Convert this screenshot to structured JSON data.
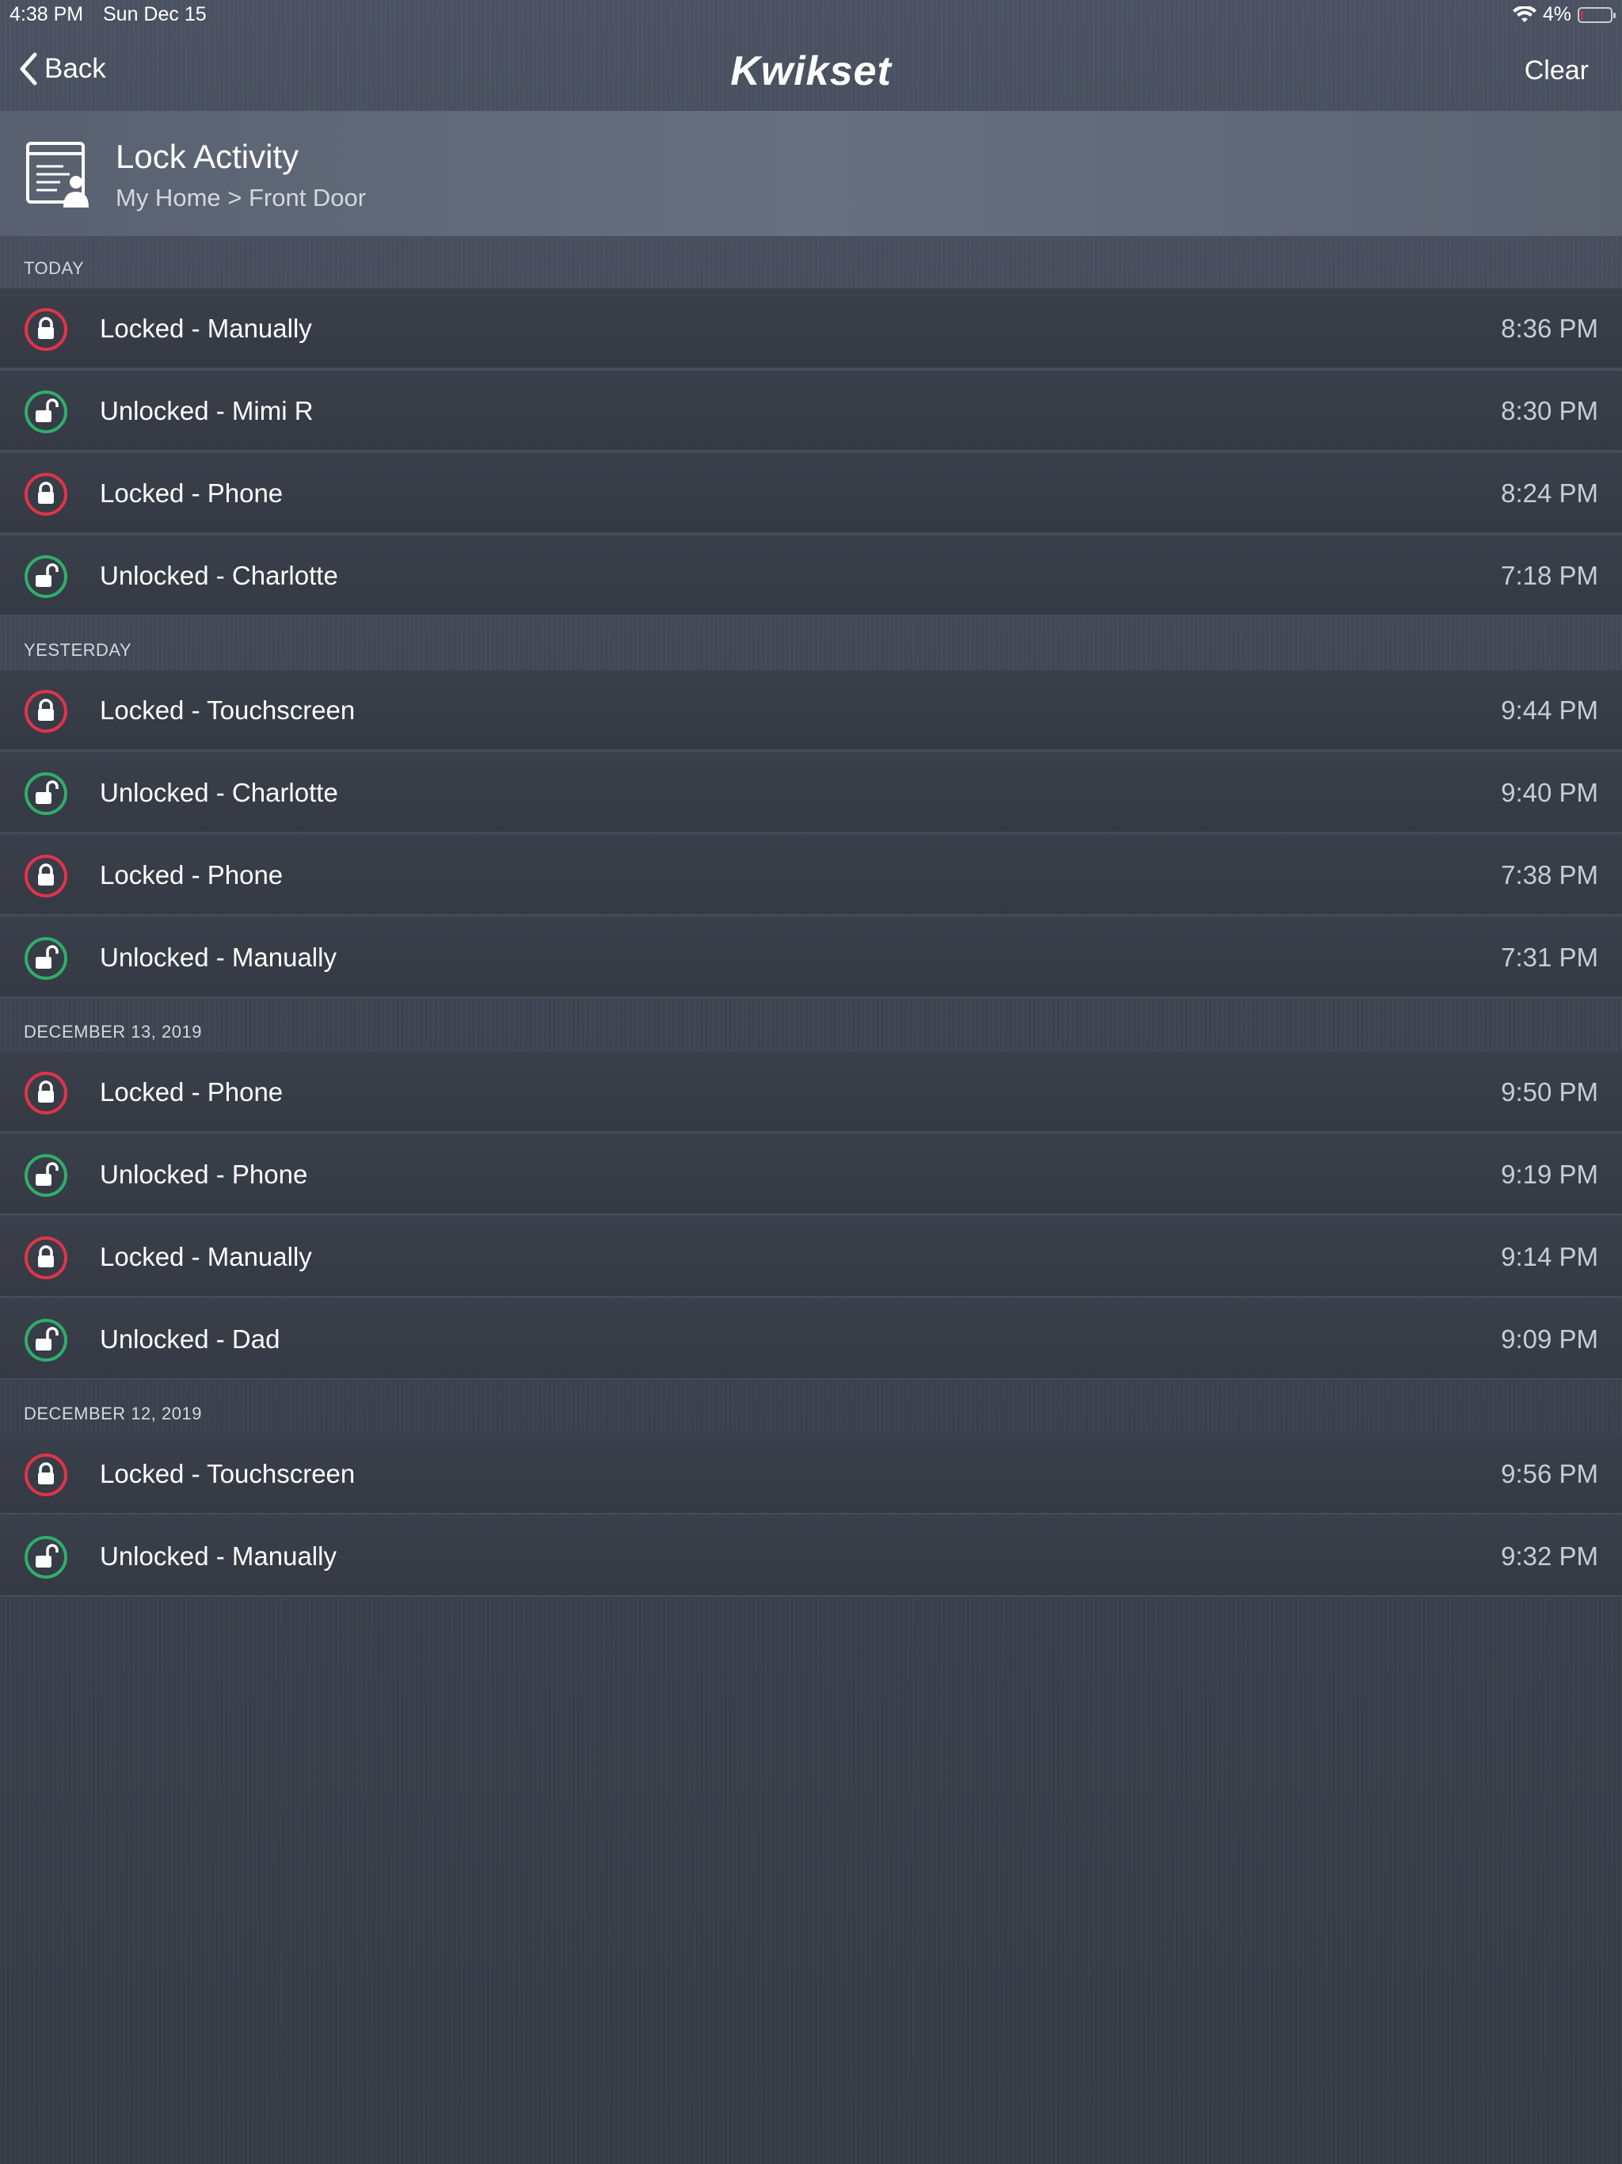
{
  "status": {
    "time": "4:38 PM",
    "date": "Sun Dec 15",
    "battery": "4%",
    "battery_level": 0.04
  },
  "nav": {
    "back_label": "Back",
    "brand": "Kwikset",
    "clear_label": "Clear"
  },
  "header": {
    "title": "Lock Activity",
    "subtitle": "My Home > Front Door",
    "icon": "activity-log-icon"
  },
  "colors": {
    "locked": "#e2334a",
    "unlocked": "#2fae6b"
  },
  "sections": [
    {
      "label": "TODAY",
      "entries": [
        {
          "text": "Locked - Manually",
          "time": "8:36 PM",
          "state": "locked"
        },
        {
          "text": "Unlocked - Mimi R",
          "time": "8:30 PM",
          "state": "unlocked"
        },
        {
          "text": "Locked - Phone",
          "time": "8:24 PM",
          "state": "locked"
        },
        {
          "text": "Unlocked - Charlotte",
          "time": "7:18 PM",
          "state": "unlocked"
        }
      ]
    },
    {
      "label": "YESTERDAY",
      "entries": [
        {
          "text": "Locked - Touchscreen",
          "time": "9:44 PM",
          "state": "locked"
        },
        {
          "text": "Unlocked - Charlotte",
          "time": "9:40 PM",
          "state": "unlocked"
        },
        {
          "text": "Locked - Phone",
          "time": "7:38 PM",
          "state": "locked"
        },
        {
          "text": "Unlocked - Manually",
          "time": "7:31 PM",
          "state": "unlocked"
        }
      ]
    },
    {
      "label": "DECEMBER 13, 2019",
      "entries": [
        {
          "text": "Locked - Phone",
          "time": "9:50 PM",
          "state": "locked"
        },
        {
          "text": "Unlocked - Phone",
          "time": "9:19 PM",
          "state": "unlocked"
        },
        {
          "text": "Locked - Manually",
          "time": "9:14 PM",
          "state": "locked"
        },
        {
          "text": "Unlocked - Dad",
          "time": "9:09 PM",
          "state": "unlocked"
        }
      ]
    },
    {
      "label": "DECEMBER 12, 2019",
      "entries": [
        {
          "text": "Locked - Touchscreen",
          "time": "9:56 PM",
          "state": "locked"
        },
        {
          "text": "Unlocked - Manually",
          "time": "9:32 PM",
          "state": "unlocked"
        }
      ]
    }
  ]
}
